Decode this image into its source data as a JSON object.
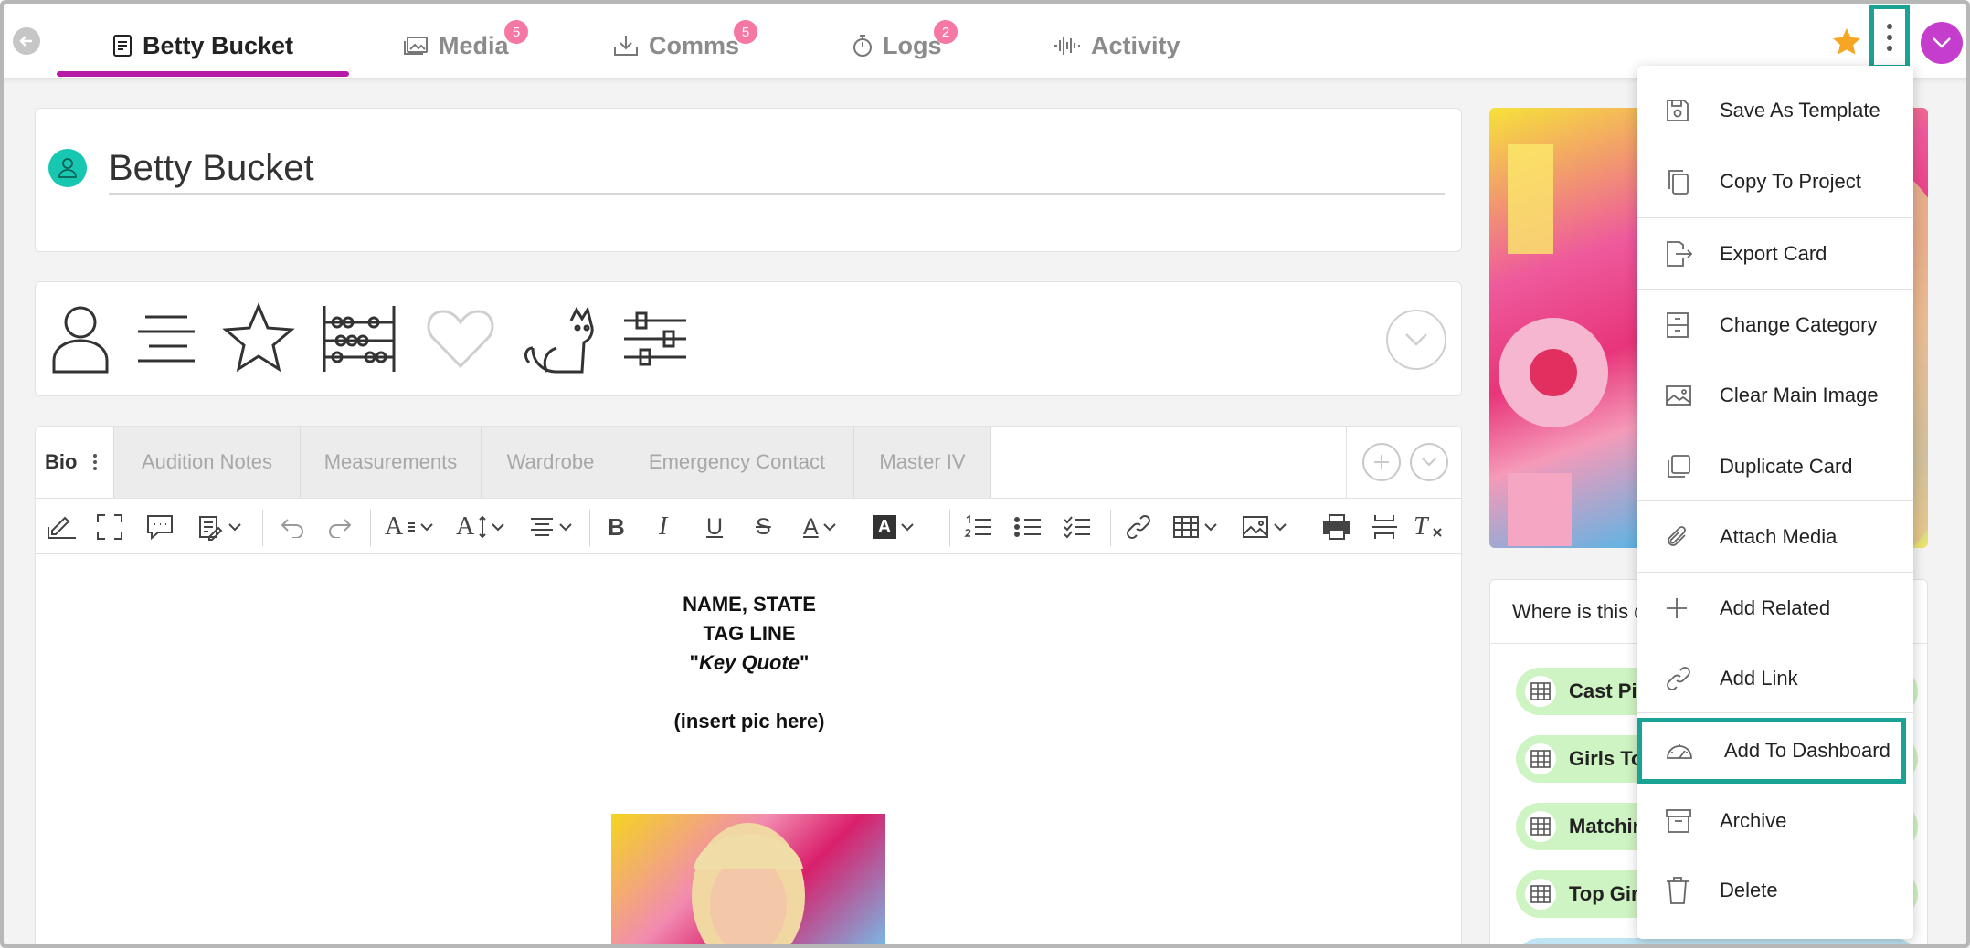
{
  "nav": {
    "tabs": [
      {
        "label": "Betty Bucket",
        "badge": ""
      },
      {
        "label": "Media",
        "badge": "5"
      },
      {
        "label": "Comms",
        "badge": "5"
      },
      {
        "label": "Logs",
        "badge": "2"
      },
      {
        "label": "Activity",
        "badge": ""
      }
    ],
    "accent_color": "#b71aa6",
    "favorite_color": "#f5a623",
    "highlight_color": "#19a394"
  },
  "card": {
    "name": "Betty Bucket"
  },
  "editor": {
    "tabs": [
      "Bio",
      "Audition Notes",
      "Measurements",
      "Wardrobe",
      "Emergency Contact",
      "Master IV"
    ],
    "toolbar_text": {
      "font_family": "A",
      "font_size": "A",
      "bold": "B",
      "italic": "I",
      "underline": "U",
      "strike": "S",
      "font_color": "A",
      "bg_color": "A",
      "clear_format": "T"
    },
    "content": {
      "line1": "NAME, STATE",
      "line2": "TAG LINE",
      "quote_open": "\"",
      "quote": "Key Quote",
      "quote_close": "\"",
      "line4": "(insert pic here)"
    }
  },
  "where": {
    "heading": "Where is this c",
    "items": [
      "Cast Pit",
      "Girls Top",
      "Matchin",
      "Top Girls"
    ]
  },
  "menu": {
    "items": [
      {
        "label": "Save As Template",
        "icon": "save-icon"
      },
      {
        "label": "Copy To Project",
        "icon": "copy-icon"
      },
      {
        "label": "Export Card",
        "icon": "export-icon"
      },
      {
        "label": "Change Category",
        "icon": "cabinet-icon"
      },
      {
        "label": "Clear Main Image",
        "icon": "image-icon"
      },
      {
        "label": "Duplicate Card",
        "icon": "duplicate-icon"
      },
      {
        "label": "Attach Media",
        "icon": "paperclip-icon"
      },
      {
        "label": "Add Related",
        "icon": "plus-icon"
      },
      {
        "label": "Add Link",
        "icon": "link-icon"
      },
      {
        "label": "Add To Dashboard",
        "icon": "gauge-icon"
      },
      {
        "label": "Archive",
        "icon": "archive-icon"
      },
      {
        "label": "Delete",
        "icon": "trash-icon"
      }
    ]
  }
}
